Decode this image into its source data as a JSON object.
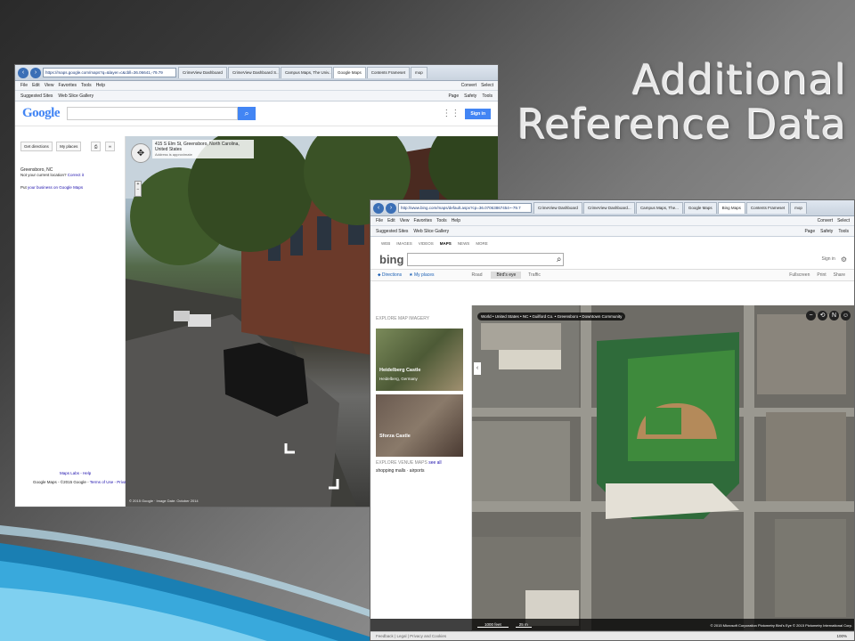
{
  "slide": {
    "title_line1": "Additional",
    "title_line2": "Reference Data"
  },
  "google_window": {
    "address": "https://maps.google.com/maps?q=&layer=c&cbll=36.06641,-79.79",
    "tabs": [
      "CrimeView Dashboard",
      "CrimeView Dashboard S...",
      "Campus Maps, The Univ...",
      "Google Maps",
      "Contents Frameset",
      "mop"
    ],
    "menu": [
      "File",
      "Edit",
      "View",
      "Favorites",
      "Tools",
      "Help"
    ],
    "menu_right": [
      "Convert",
      "Select"
    ],
    "fav": [
      "Suggested Sites",
      "Web Slice Gallery"
    ],
    "fav_right": [
      "Page",
      "Safety",
      "Tools"
    ],
    "logo": "Google",
    "signin": "Sign in",
    "get_directions": "Get directions",
    "my_places": "My places",
    "location_title": "Greensboro, NC",
    "location_question": "Not your current location?",
    "correct_it": "Correct it",
    "put_prefix": "Put",
    "business_link": "your business on Google Maps",
    "street_address": "415 S Elm St, Greensboro, North Carolina, United States",
    "address_approx": "Address is approximate",
    "map_labs": "Maps Labs - Help",
    "footer": "Google Maps - ©2015 Google -",
    "terms": "Terms of Use - Privacy",
    "image_date": "© 2015 Google · Image Date: October 2014"
  },
  "bing_window": {
    "address": "http://www.bing.com/maps/default.aspx?cp=36.07063867454~-79.7",
    "tabs": [
      "CrimeView Dashboard",
      "CrimeView Dashboard...",
      "Campus Maps, The...",
      "Google Maps",
      "Bing Maps",
      "Contents Frameset",
      "mop"
    ],
    "menu": [
      "File",
      "Edit",
      "View",
      "Favorites",
      "Tools",
      "Help"
    ],
    "menu_right": [
      "Convert",
      "Select"
    ],
    "fav": [
      "Suggested Sites",
      "Web Slice Gallery"
    ],
    "fav_right": [
      "Page",
      "Safety",
      "Tools"
    ],
    "nav": [
      "WEB",
      "IMAGES",
      "VIDEOS",
      "MAPS",
      "NEWS",
      "MORE"
    ],
    "logo": "bing",
    "signin": "Sign in",
    "directions": "Directions",
    "my_places": "My places",
    "road": "Road",
    "birds_eye": "Bird's eye",
    "traffic": "Traffic",
    "fullscreen": "Fullscreen",
    "print": "Print",
    "share": "Share",
    "explore_imagery": "EXPLORE MAP IMAGERY",
    "thumb1_title": "Heidelberg Castle",
    "thumb1_sub": "Heidelberg, Germany",
    "thumb2_title": "Sforza Castle",
    "explore_venue": "EXPLORE VENUE MAPS",
    "see_all": "see all",
    "venue_links": "shopping malls · airports",
    "breadcrumb": "World • United States • NC • Guilford Co. • Greensboro • Downtown Community",
    "scale_feet": "1000 feet",
    "scale_m": "25 m",
    "copyright": "© 2015 Microsoft Corporation   Pictometry Bird's Eye © 2015 Pictometry International Corp.",
    "feedback": "Feedback",
    "legal": "Legal",
    "privacy": "Privacy and Cookies",
    "zoom": "100%"
  }
}
